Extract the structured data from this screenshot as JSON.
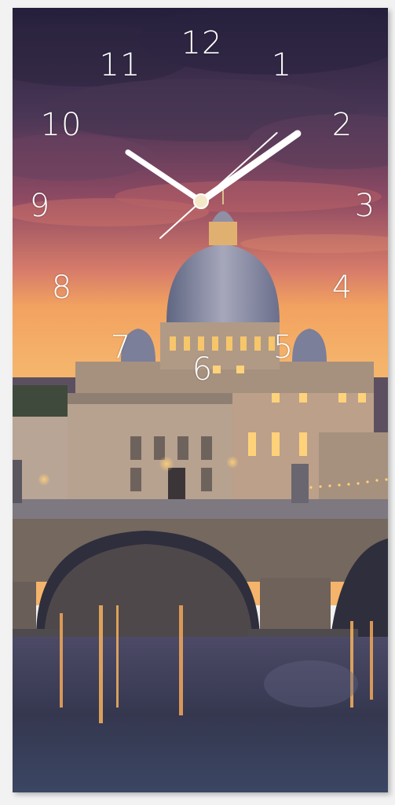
{
  "clock": {
    "numerals": [
      "12",
      "1",
      "2",
      "3",
      "4",
      "5",
      "6",
      "7",
      "8",
      "9",
      "10",
      "11"
    ],
    "time": {
      "hour": 1,
      "minute": 50,
      "second": 38
    },
    "hand_color": "#ffffff"
  },
  "scene": {
    "sky_top": "#2a2440",
    "sky_mid": "#b2566a",
    "horizon": "#f2a260",
    "dome_color": "#8b8fa8",
    "building_color": "#a5907e",
    "lights_color": "#ffd27a",
    "water_color": "#3c3f5e"
  }
}
